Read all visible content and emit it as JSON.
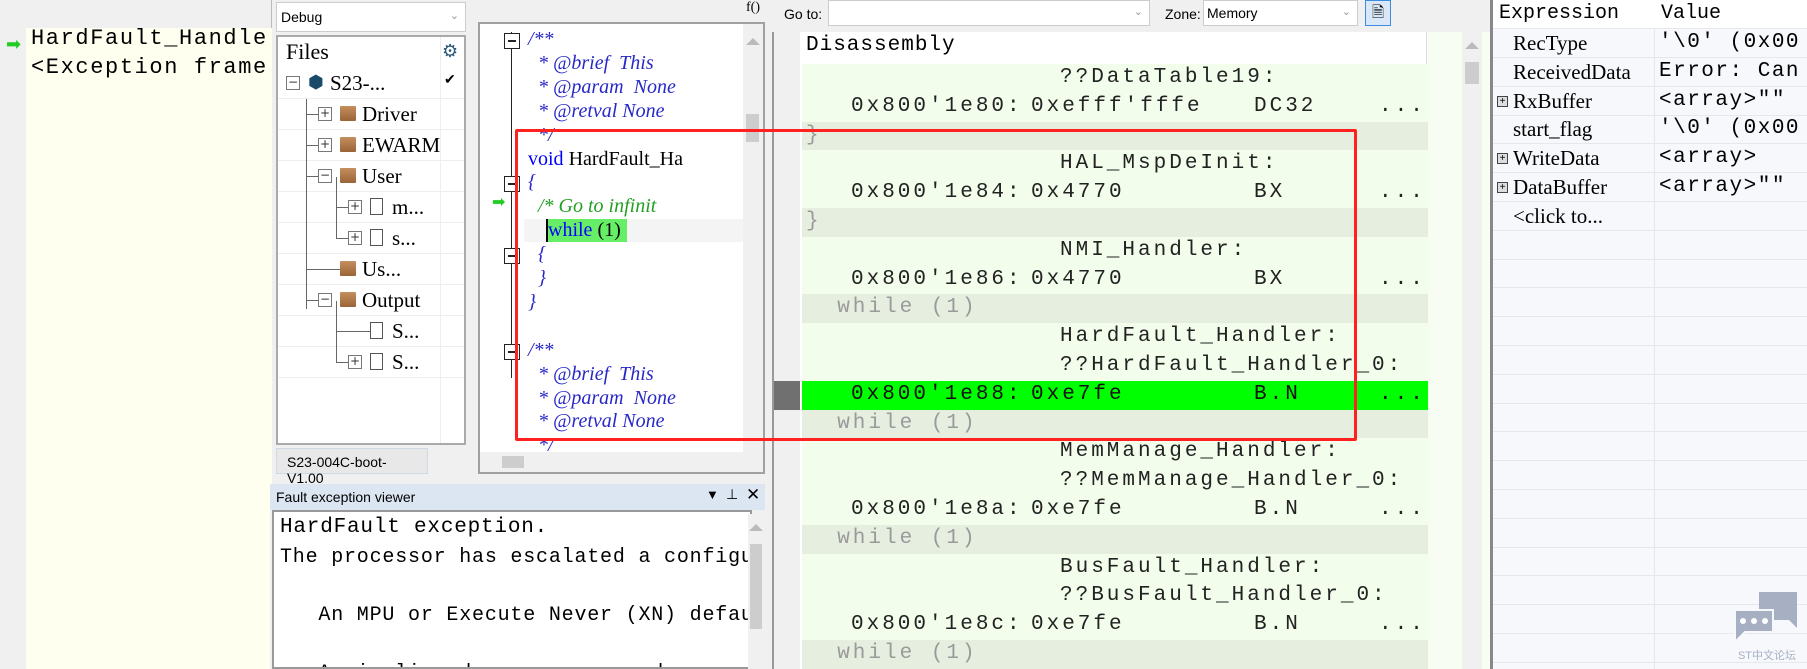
{
  "call_stack": {
    "lines": [
      "HardFault_Handle",
      "<Exception frame"
    ]
  },
  "workspace": {
    "config": "Debug",
    "tree_header": "Files",
    "items": [
      {
        "label": "S23-...",
        "icon": "project-icon",
        "level": 0,
        "expander": "minus",
        "check": true
      },
      {
        "label": "Driver",
        "icon": "folder-icon",
        "level": 1,
        "expander": "plus"
      },
      {
        "label": "EWARM",
        "icon": "folder-icon",
        "level": 1,
        "expander": "plus"
      },
      {
        "label": "User",
        "icon": "folder-icon",
        "level": 1,
        "expander": "minus"
      },
      {
        "label": "m...",
        "icon": "c-file-icon",
        "level": 2,
        "expander": "plus"
      },
      {
        "label": "s...",
        "icon": "c-file-icon",
        "level": 2,
        "expander": "plus"
      },
      {
        "label": "Us...",
        "icon": "folder-icon",
        "level": 1,
        "expander": "none"
      },
      {
        "label": "Output",
        "icon": "folder-icon",
        "level": 1,
        "expander": "minus"
      },
      {
        "label": "S...",
        "icon": "text-file-icon",
        "level": 2,
        "expander": "none"
      },
      {
        "label": "S...",
        "icon": "file-icon",
        "level": 2,
        "expander": "plus"
      }
    ],
    "tab": "S23-004C-boot-V1.00"
  },
  "editor": {
    "func_icon": "f()",
    "lines": [
      {
        "text": "/**",
        "kind": "comment",
        "fold": true
      },
      {
        "text": "  * @brief  This",
        "kind": "comment"
      },
      {
        "text": "  * @param  None",
        "kind": "comment"
      },
      {
        "text": "  * @retval None",
        "kind": "comment"
      },
      {
        "text": "  */",
        "kind": "comment"
      },
      {
        "text": "void HardFault_Ha",
        "kind": "void"
      },
      {
        "text": "{",
        "kind": "comment",
        "fold": true
      },
      {
        "text": "  /* Go to infinit",
        "kind": "green"
      },
      {
        "text": "  while (1)",
        "kind": "while",
        "current": true
      },
      {
        "text": "  {",
        "kind": "comment",
        "fold": true
      },
      {
        "text": "  }",
        "kind": "comment"
      },
      {
        "text": "}",
        "kind": "comment"
      },
      {
        "text": "",
        "kind": "text"
      },
      {
        "text": "/**",
        "kind": "comment",
        "fold": true
      },
      {
        "text": "  * @brief  This",
        "kind": "comment"
      },
      {
        "text": "  * @param  None",
        "kind": "comment"
      },
      {
        "text": "  * @retval None",
        "kind": "comment"
      },
      {
        "text": "  */",
        "kind": "comment"
      }
    ]
  },
  "fault_viewer": {
    "title": "Fault exception viewer",
    "lines": [
      "HardFault exception.",
      "The processor has escalated a configurable",
      "",
      "   An MPU or Execute Never (XN) default me",
      "",
      "   A misaligned access was made"
    ]
  },
  "disassembly": {
    "goto_label": "Go to:",
    "goto_value": "",
    "zone_label": "Zone:",
    "zone_value": "Memory",
    "title": "Disassembly",
    "rows": [
      {
        "kind": "label",
        "text": "??DataTable19:"
      },
      {
        "kind": "code",
        "addr": "0x800'1e80:",
        "value": "0xefff'fffe",
        "mnemonic": "DC32",
        "operand": "..."
      },
      {
        "kind": "src",
        "text": "}"
      },
      {
        "kind": "label",
        "text": "HAL_MspDeInit:"
      },
      {
        "kind": "code",
        "addr": "0x800'1e84:",
        "value": "0x4770",
        "mnemonic": "BX",
        "operand": "..."
      },
      {
        "kind": "src",
        "text": "}"
      },
      {
        "kind": "label",
        "text": "NMI_Handler:"
      },
      {
        "kind": "code",
        "addr": "0x800'1e86:",
        "value": "0x4770",
        "mnemonic": "BX",
        "operand": "..."
      },
      {
        "kind": "src",
        "text": "  while (1)"
      },
      {
        "kind": "label",
        "text": "HardFault_Handler:"
      },
      {
        "kind": "label",
        "text": "??HardFault_Handler_0:"
      },
      {
        "kind": "code",
        "addr": "0x800'1e88:",
        "value": "0xe7fe",
        "mnemonic": "B.N",
        "operand": "...",
        "current": true
      },
      {
        "kind": "src",
        "text": "  while (1)"
      },
      {
        "kind": "label",
        "text": "MemManage_Handler:"
      },
      {
        "kind": "label",
        "text": "??MemManage_Handler_0:"
      },
      {
        "kind": "code",
        "addr": "0x800'1e8a:",
        "value": "0xe7fe",
        "mnemonic": "B.N",
        "operand": "..."
      },
      {
        "kind": "src",
        "text": "  while (1)"
      },
      {
        "kind": "label",
        "text": "BusFault_Handler:"
      },
      {
        "kind": "label",
        "text": "??BusFault_Handler_0:"
      },
      {
        "kind": "code",
        "addr": "0x800'1e8c:",
        "value": "0xe7fe",
        "mnemonic": "B.N",
        "operand": "..."
      },
      {
        "kind": "src",
        "text": "  while (1)"
      }
    ]
  },
  "watch": {
    "headers": [
      "Expression",
      "Value"
    ],
    "rows": [
      {
        "expr": "RecType",
        "value": "'\\0' (0x00",
        "expandable": false
      },
      {
        "expr": "ReceivedData",
        "value": "Error: Can",
        "expandable": false
      },
      {
        "expr": "RxBuffer",
        "value": "<array>\"\"",
        "expandable": true
      },
      {
        "expr": "start_flag",
        "value": "'\\0' (0x00",
        "expandable": false
      },
      {
        "expr": "WriteData",
        "value": "<array>",
        "expandable": true
      },
      {
        "expr": "DataBuffer",
        "value": "<array>\"\"",
        "expandable": true
      },
      {
        "expr": "<click to...",
        "value": "",
        "expandable": false
      }
    ]
  },
  "watermark": "ST中文论坛",
  "colors": {
    "current_line": "#00ff00",
    "annotation_box": "#ff2020",
    "disasm_bg": "#f3fdeb",
    "source_line_bg": "#e6eedf"
  }
}
